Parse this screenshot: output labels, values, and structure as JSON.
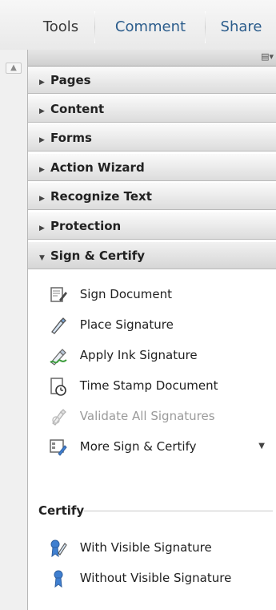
{
  "tabs": {
    "tools": "Tools",
    "comment": "Comment",
    "share": "Share"
  },
  "panel": {
    "sections": [
      "Pages",
      "Content",
      "Forms",
      "Action Wizard",
      "Recognize Text",
      "Protection",
      "Sign & Certify"
    ],
    "open_section": "Sign & Certify",
    "items": [
      {
        "label": "Sign Document",
        "icon": "sign-document-icon",
        "enabled": true
      },
      {
        "label": "Place Signature",
        "icon": "pen-icon",
        "enabled": true
      },
      {
        "label": "Apply Ink Signature",
        "icon": "ink-signature-icon",
        "enabled": true
      },
      {
        "label": "Time Stamp Document",
        "icon": "timestamp-icon",
        "enabled": true
      },
      {
        "label": "Validate All Signatures",
        "icon": "validate-icon",
        "enabled": false
      },
      {
        "label": "More Sign & Certify",
        "icon": "more-sign-icon",
        "enabled": true
      }
    ],
    "certify_label": "Certify",
    "certify_items": [
      {
        "label": "With Visible Signature",
        "icon": "ribbon-pen-icon"
      },
      {
        "label": "Without Visible Signature",
        "icon": "ribbon-icon"
      }
    ]
  },
  "colors": {
    "tab_active": "#3a3a3a",
    "tab_link": "#2c5d8c",
    "item_disabled": "#9a9a9a",
    "ribbon_blue": "#3f7fd0"
  }
}
